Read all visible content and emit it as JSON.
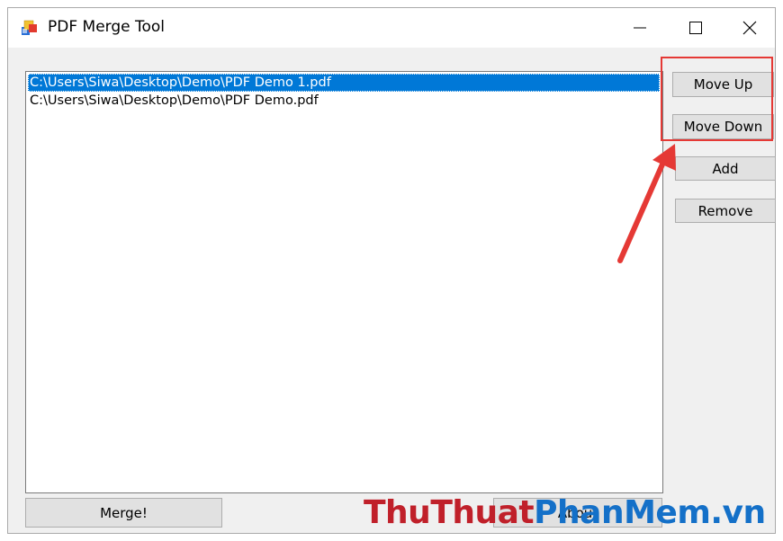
{
  "window": {
    "title": "PDF Merge Tool"
  },
  "controls": {
    "minimize": "minimize",
    "maximize": "maximize",
    "close": "close"
  },
  "file_list": {
    "items": [
      {
        "path": "C:\\Users\\Siwa\\Desktop\\Demo\\PDF Demo 1.pdf",
        "selected": true
      },
      {
        "path": "C:\\Users\\Siwa\\Desktop\\Demo\\PDF Demo.pdf",
        "selected": false
      }
    ]
  },
  "buttons": {
    "move_up": "Move Up",
    "move_down": "Move Down",
    "add": "Add",
    "remove": "Remove",
    "merge": "Merge!",
    "about": "About"
  },
  "watermark": {
    "part1": "ThuThuat",
    "part2": "PhanMem",
    "part3": ".vn"
  },
  "colors": {
    "selection": "#0078d7",
    "highlight": "#e53935",
    "watermark_red": "#c0202a",
    "watermark_blue": "#1470c8"
  }
}
